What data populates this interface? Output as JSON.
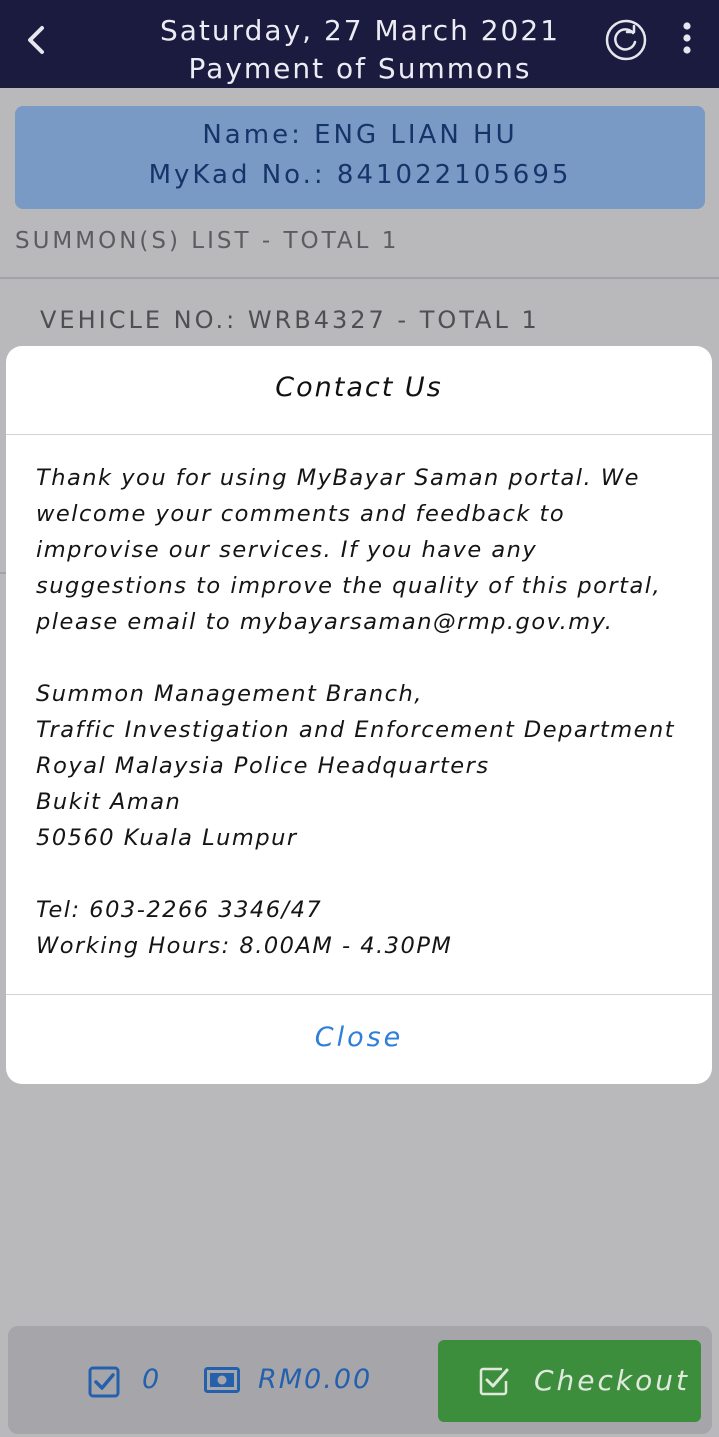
{
  "header": {
    "date": "Saturday, 27 March 2021",
    "subtitle": "Payment of Summons",
    "icons": [
      "back-icon",
      "refresh-icon",
      "more-vert-icon"
    ]
  },
  "profile": {
    "name_line": "Name: ENG LIAN HU",
    "mykad_line": "MyKad No.: 841022105695"
  },
  "summons": {
    "list_heading": "SUMMON(S) LIST - TOTAL 1",
    "vehicle_heading": "VEHICLE NO.: WRB4327 - TOTAL 1"
  },
  "dialog": {
    "title": "Contact Us",
    "intro": "Thank you for using MyBayar Saman portal. We welcome your comments and feedback to improvise our services. If you have any suggestions to improve the quality of this portal, please email to mybayarsaman@rmp.gov.my.",
    "address": [
      "Summon Management Branch,",
      "Traffic Investigation and Enforcement Department",
      "Royal Malaysia Police Headquarters",
      "Bukit Aman",
      "50560 Kuala Lumpur"
    ],
    "tel": "Tel: 603-2266 3346/47",
    "hours": "Working Hours: 8.00AM - 4.30PM",
    "close_label": "Close"
  },
  "footer": {
    "selected_count": "0",
    "total_amount": "RM0.00",
    "checkout_label": "Checkout"
  },
  "colors": {
    "header_bg": "#1b1b3f",
    "profile_bg": "#7a9ac6",
    "link_blue": "#2e7fd9",
    "checkout_green": "#3d8e3c"
  }
}
